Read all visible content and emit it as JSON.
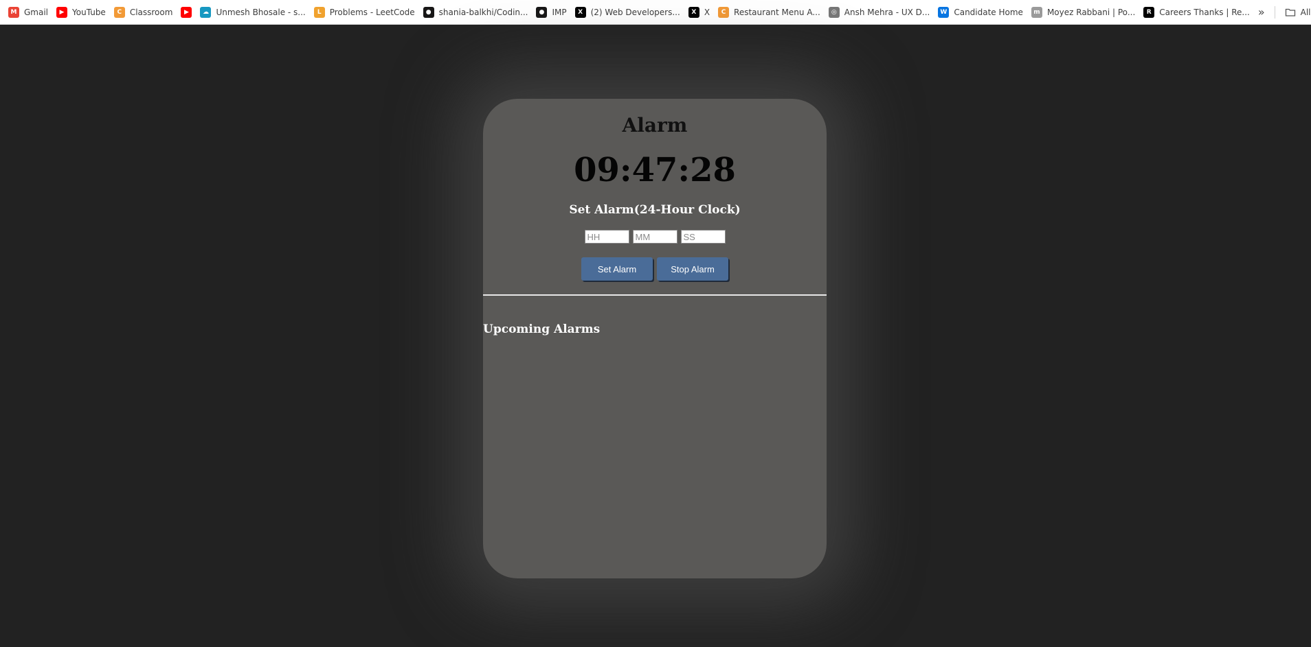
{
  "bookmarks": [
    {
      "label": "Gmail",
      "icon": "gmail-icon",
      "color": "#ea4335",
      "glyph": "M"
    },
    {
      "label": "YouTube",
      "icon": "youtube-icon",
      "color": "#ff0000",
      "glyph": "▶"
    },
    {
      "label": "Classroom",
      "icon": "classroom-icon",
      "color": "#f29a37",
      "glyph": "C"
    },
    {
      "label": "",
      "icon": "youtube-icon",
      "color": "#ff0000",
      "glyph": "▶"
    },
    {
      "label": "Unmesh Bhosale - s...",
      "icon": "salesforce-icon",
      "color": "#1798c1",
      "glyph": "☁"
    },
    {
      "label": "Problems - LeetCode",
      "icon": "leetcode-icon",
      "color": "#f0a22e",
      "glyph": "L"
    },
    {
      "label": "shania-balkhi/Codin...",
      "icon": "github-icon",
      "color": "#181717",
      "glyph": "●"
    },
    {
      "label": "IMP",
      "icon": "github-icon",
      "color": "#181717",
      "glyph": "●"
    },
    {
      "label": "(2) Web Developers...",
      "icon": "x-icon",
      "color": "#000000",
      "glyph": "X"
    },
    {
      "label": "X",
      "icon": "x-icon",
      "color": "#000000",
      "glyph": "X"
    },
    {
      "label": "Restaurant Menu A...",
      "icon": "codecademy-icon",
      "color": "#f29a37",
      "glyph": "C"
    },
    {
      "label": "Ansh Mehra - UX D...",
      "icon": "site-icon",
      "color": "#777777",
      "glyph": "◎"
    },
    {
      "label": "Candidate Home",
      "icon": "workday-icon",
      "color": "#0875e1",
      "glyph": "W"
    },
    {
      "label": "Moyez Rabbani | Po...",
      "icon": "portfolio-icon",
      "color": "#9a9a9a",
      "glyph": "m"
    },
    {
      "label": "Careers Thanks | Re...",
      "icon": "r-icon",
      "color": "#000000",
      "glyph": "R"
    }
  ],
  "bookmarks_overflow": "»",
  "all_bookmarks_label": "All Bookmarks",
  "app": {
    "title": "Alarm",
    "time": "09:47:28",
    "set_alarm_heading": "Set Alarm(24-Hour Clock)",
    "inputs": {
      "hours_placeholder": "HH",
      "minutes_placeholder": "MM",
      "seconds_placeholder": "SS"
    },
    "set_button": "Set Alarm",
    "stop_button": "Stop Alarm",
    "upcoming_heading": "Upcoming Alarms",
    "upcoming_alarms": []
  },
  "colors": {
    "page_background": "#222222",
    "card_background": "#5a5957",
    "button_background": "#4a6c98"
  }
}
